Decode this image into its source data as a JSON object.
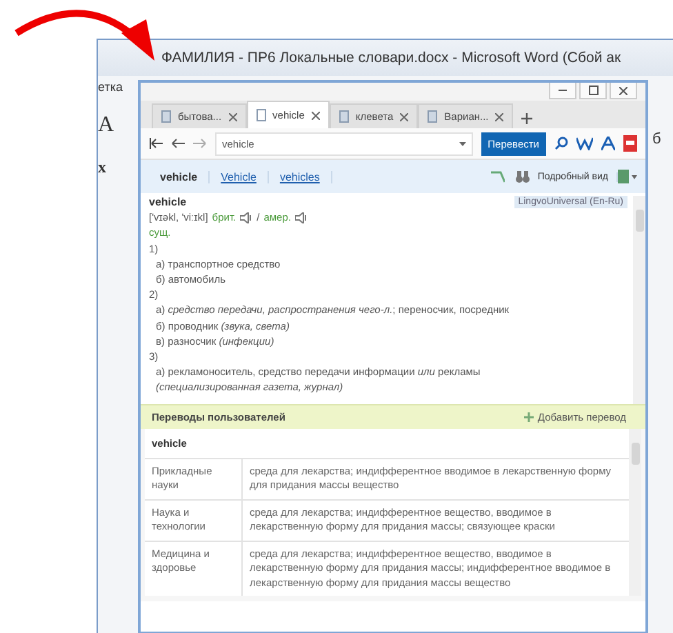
{
  "word_window": {
    "title": "ФАМИЛИЯ - ПР6 Локальные словари.docx - Microsoft Word (Сбой ак",
    "left_fragments": [
      "етка",
      "A",
      "x"
    ],
    "right_fragments": [
      "б"
    ]
  },
  "lingvo": {
    "tabs": [
      {
        "label": "бытова...",
        "selected": false
      },
      {
        "label": "vehicle",
        "selected": true
      },
      {
        "label": "клевета",
        "selected": false
      },
      {
        "label": "Вариан...",
        "selected": false
      }
    ],
    "search": {
      "value": "vehicle"
    },
    "translate_button": "Перевести",
    "forms": [
      {
        "label": "vehicle",
        "selected": true
      },
      {
        "label": "Vehicle",
        "selected": false
      },
      {
        "label": "vehicles",
        "selected": false
      }
    ],
    "view_button": "Подробный вид",
    "entry": {
      "headword": "vehicle",
      "dictionary": "LingvoUniversal (En-Ru)",
      "transcription": "['vɪəkl, 'viːɪkl]",
      "pron_labels": [
        "брит.",
        "амер."
      ],
      "separator": "/",
      "part_of_speech": "сущ.",
      "lines": [
        {
          "kind": "number",
          "text": "1)"
        },
        {
          "kind": "sense",
          "text": "а) транспортное средство"
        },
        {
          "kind": "sense",
          "text": "б) автомобиль"
        },
        {
          "kind": "number",
          "text": "2)"
        },
        {
          "kind": "sense",
          "text": "а) *средство передачи, распространения чего-л.*; переносчик, посредник"
        },
        {
          "kind": "sense",
          "text": "б) проводник *(звука, света)*"
        },
        {
          "kind": "sense",
          "text": "в) разносчик *(инфекции)*"
        },
        {
          "kind": "number",
          "text": "3)"
        },
        {
          "kind": "sense",
          "text": "а) рекламоноситель, средство передачи информации *или* рекламы"
        },
        {
          "kind": "sense",
          "text": "*(специализированная газета, журнал)*"
        }
      ]
    },
    "user_translations": {
      "title": "Переводы пользователей",
      "add_button": "Добавить перевод",
      "word": "vehicle",
      "rows": [
        {
          "area": "Прикладные науки",
          "text": "среда для лекарства; индифферентное вводимое в лекарственную форму для придания массы вещество"
        },
        {
          "area": "Наука и технологии",
          "text": "среда для лекарства; индифферентное вещество, вводимое в лекарственную форму для придания массы; связующее краски"
        },
        {
          "area": "Медицина и здоровье",
          "text": "среда для лекарства; индифферентное вещество, вводимое в лекарственную форму для придания массы; индифферентное вводимое в лекарственную форму для придания массы вещество"
        }
      ]
    }
  }
}
